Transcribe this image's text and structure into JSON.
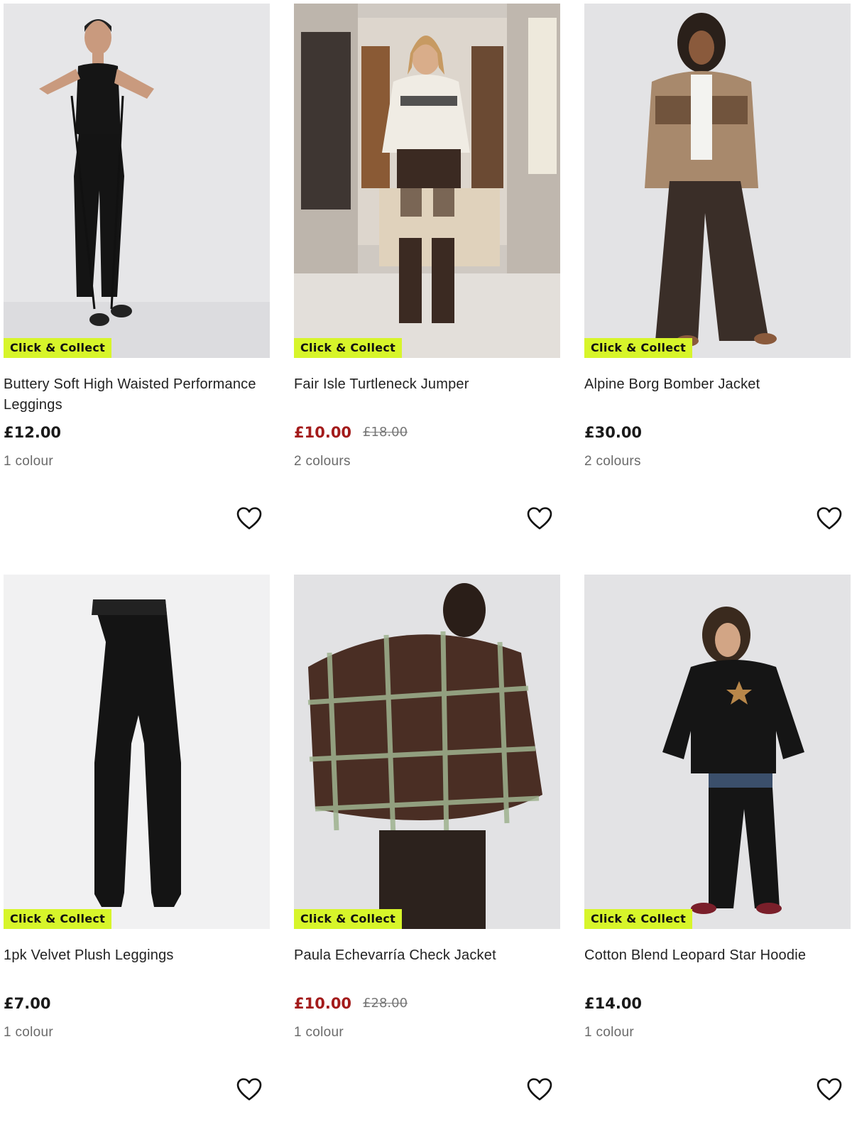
{
  "badge_color": "#d7f52a",
  "sale_color": "#a31b1b",
  "products": [
    {
      "badge": "Click & Collect",
      "title": "Buttery Soft High Waisted Performance Leggings",
      "price": "£12.00",
      "was_price": "",
      "colours": "1 colour",
      "favourite_icon": "heart-outline-icon"
    },
    {
      "badge": "Click & Collect",
      "title": "Fair Isle Turtleneck Jumper",
      "price": "£10.00",
      "was_price": "£18.00",
      "colours": "2 colours",
      "favourite_icon": "heart-outline-icon"
    },
    {
      "badge": "Click & Collect",
      "title": "Alpine Borg Bomber Jacket",
      "price": "£30.00",
      "was_price": "",
      "colours": "2 colours",
      "favourite_icon": "heart-outline-icon"
    },
    {
      "badge": "Click & Collect",
      "title": "1pk Velvet Plush Leggings",
      "price": "£7.00",
      "was_price": "",
      "colours": "1 colour",
      "favourite_icon": "heart-outline-icon"
    },
    {
      "badge": "Click & Collect",
      "title": "Paula Echevarría Check Jacket",
      "price": "£10.00",
      "was_price": "£28.00",
      "colours": "1 colour",
      "favourite_icon": "heart-outline-icon"
    },
    {
      "badge": "Click & Collect",
      "title": "Cotton Blend Leopard Star Hoodie",
      "price": "£14.00",
      "was_price": "",
      "colours": "1 colour",
      "favourite_icon": "heart-outline-icon"
    }
  ]
}
